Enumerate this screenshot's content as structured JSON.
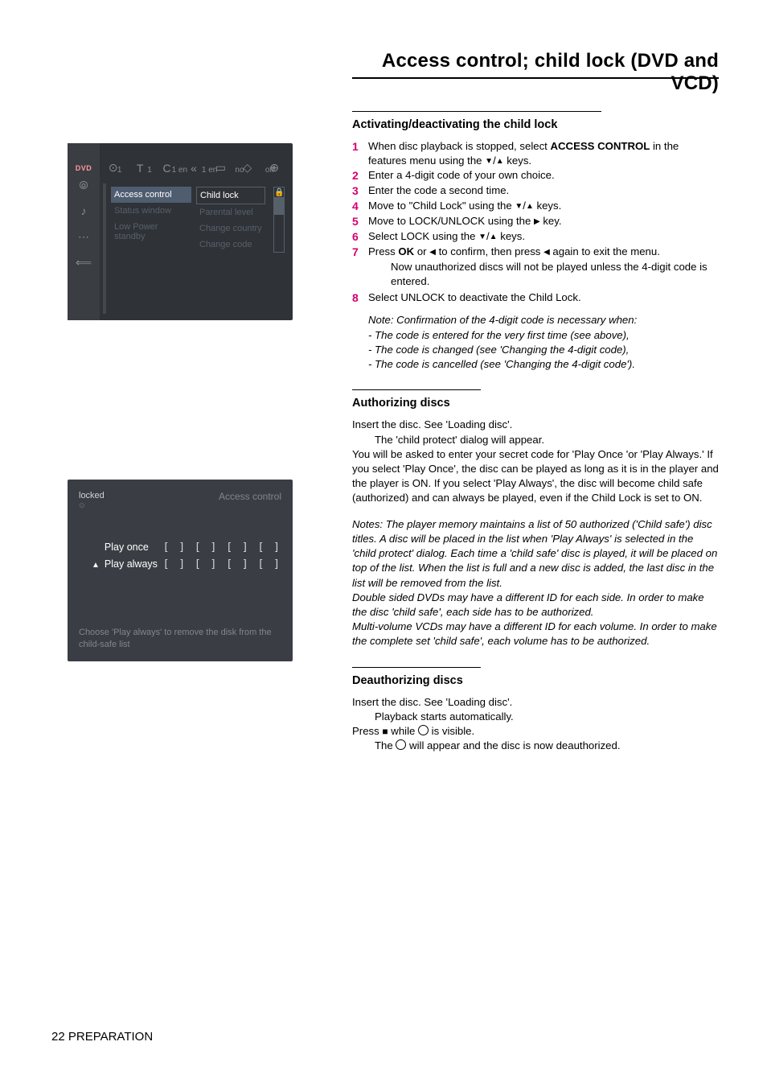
{
  "title": "Access control; child lock (DVD and VCD)",
  "footer": "22 PREPARATION",
  "sec1": {
    "heading": "Activating/deactivating the child lock",
    "steps": {
      "s1a": "When disc playback is stopped, select ",
      "s1b": "ACCESS CONTROL",
      "s1c": " in the features menu using the ",
      "s1d": " keys.",
      "s2": "Enter a 4-digit code of your own choice.",
      "s3": "Enter the code a second time.",
      "s4a": "Move to \"Child Lock\" using the ",
      "s4b": "  keys.",
      "s5a": "Move to LOCK/UNLOCK using the ",
      "s5b": "  key.",
      "s6a": "Select LOCK using the ",
      "s6b": "  keys.",
      "s7a": "Press ",
      "s7b": "OK",
      "s7c": " or ",
      "s7d": " to confirm, then press ",
      "s7e": " again to exit the menu.",
      "s7sub": "Now unauthorized discs will not be played unless the 4-digit code is entered.",
      "s8": "Select UNLOCK to deactivate the Child Lock."
    },
    "note": {
      "l1": "Note: Confirmation of the 4-digit code is necessary when:",
      "l2": "- The code is entered for the very first time (see above),",
      "l3": "- The code is changed (see 'Changing the 4-digit code),",
      "l4": "- The code is cancelled (see 'Changing the 4-digit code')."
    }
  },
  "sec2": {
    "heading": "Authorizing discs",
    "p1": "Insert the disc. See 'Loading disc'.",
    "p1sub": "The 'child protect' dialog will appear.",
    "p2": "You will be asked to enter your secret code for 'Play Once 'or 'Play Always.' If you select 'Play Once', the disc can be played as long as it is in the player and the player is ON. If you select 'Play Always', the disc will become child safe (authorized) and can always be played, even if the Child Lock is set to ON.",
    "note": {
      "l1": "Notes: The player memory maintains a list of 50 authorized ('Child safe') disc titles. A disc will be placed in the list when 'Play Always' is selected in the 'child protect' dialog. Each time a 'child safe' disc is played, it will be placed on top of the list. When the list is full and a new disc is added, the last disc in the list will be removed from the list.",
      "l2": "Double sided DVDs may have a different ID for each side. In order to make the disc 'child safe', each side has to be authorized.",
      "l3": "Multi-volume VCDs may have a different ID for each volume. In order to make the complete set 'child safe', each volume has to be authorized."
    }
  },
  "sec3": {
    "heading": "Deauthorizing discs",
    "p1": "Insert the disc. See 'Loading disc'.",
    "p1sub": "Playback starts automatically.",
    "p2a": "Press ",
    "p2b": "  while ",
    "p2c": " is visible.",
    "p3a": "The ",
    "p3b": " will appear and the disc is now deauthorized."
  },
  "fig1": {
    "dvd": "DVD",
    "top_icons": {
      "a": "T",
      "b": "C",
      "e": "no",
      "f": "off"
    },
    "top_row2": {
      "a": "1",
      "b": "1",
      "c": "1 en",
      "d": "1 en",
      "e": "no",
      "f": "off"
    },
    "mid": {
      "i1": "Access control",
      "i2": "Status window",
      "i3": "Low Power standby"
    },
    "right": {
      "i1": "Child lock",
      "i2": "Parental level",
      "i3": "Change country",
      "i4": "Change code"
    }
  },
  "fig2": {
    "locked": "locked",
    "ac": "Access control",
    "opt1": "Play once",
    "opt2": "Play always",
    "code": "[ ] [ ] [ ] [ ]",
    "hint": "Choose 'Play always' to remove the disk from the child-safe list"
  }
}
